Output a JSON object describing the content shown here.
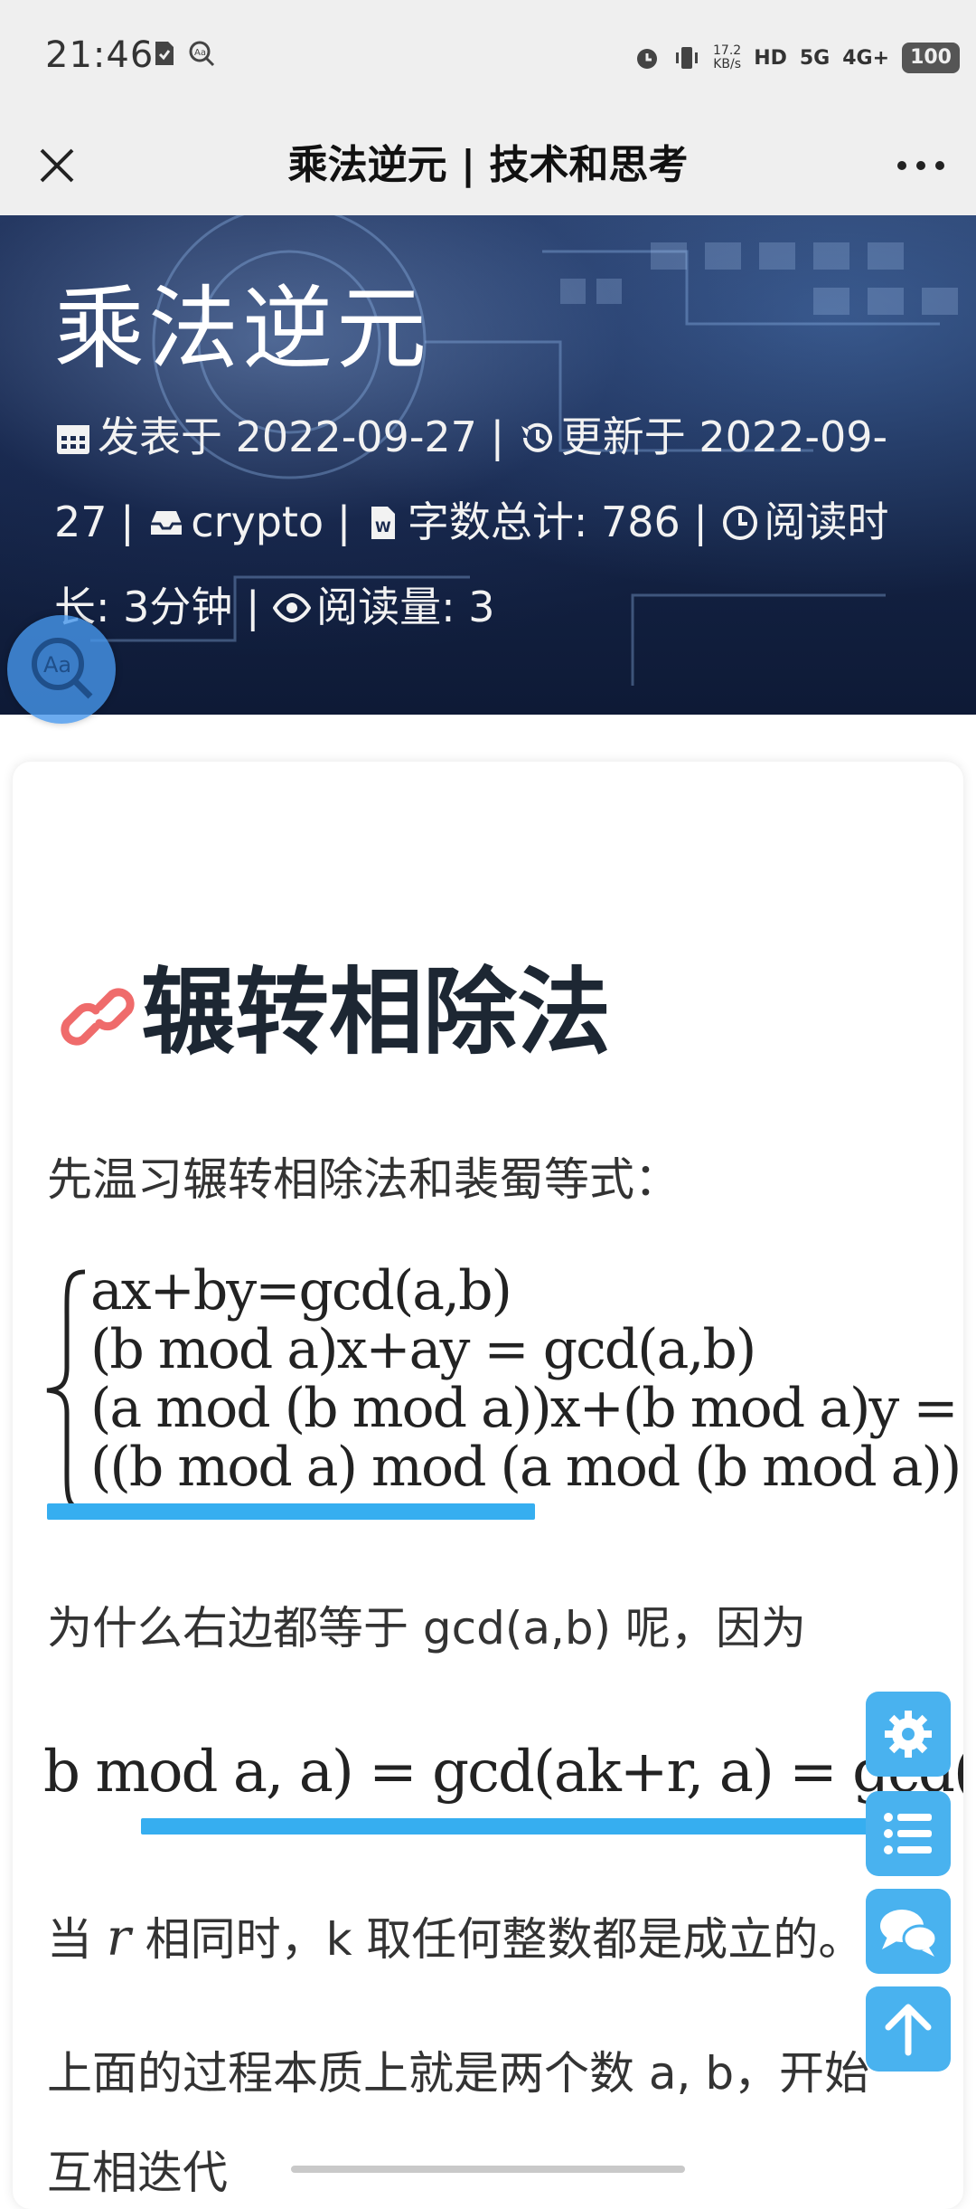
{
  "status_bar": {
    "time": "21:46",
    "speed_value": "17.2",
    "speed_unit": "KB/s",
    "hd_tag": "HD",
    "net_5g": "5G",
    "net_4g": "4G+",
    "battery": "100",
    "icons": [
      "sim-card-icon",
      "accessibility-icon",
      "alarm-icon",
      "vibrate-icon"
    ]
  },
  "title_bar": {
    "title": "乘法逆元 | 技术和思考",
    "close_icon": "close-icon",
    "more_icon": "more-dots-icon"
  },
  "hero": {
    "title": "乘法逆元",
    "published_label": "发表于 2022-09-27",
    "updated_label": "更新于 2022-09-27",
    "category": "crypto",
    "word_count": "字数总计: 786",
    "reading_time": "阅读时长: 3分钟",
    "views": "阅读量: 3",
    "sep": "|"
  },
  "article": {
    "heading": "辗转相除法",
    "intro": "先温习辗转相除法和裴蜀等式：",
    "eq1_lines": [
      "ax+by=gcd(a,b)",
      "(b mod a)x+ay = gcd(a,b)",
      "(a mod (b mod a))x+(b mod a)y = g",
      "((b mod a) mod (a mod (b mod a)))x+"
    ],
    "question": "为什么右边都等于 gcd(a,b) 呢，因为",
    "eq2": "b mod a, a) = gcd(ak+r, a) = gcd(r, a)",
    "when_text_pre": "当 ",
    "when_var": "r",
    "when_text_post": " 相同时，k 取任何整数都是成立的。",
    "process_text": "上面的过程本质上就是两个数 a, b，开始",
    "process_text_2": "互相迭代"
  },
  "floating_buttons": [
    "settings-icon",
    "toc-list-icon",
    "comments-icon",
    "back-to-top-icon"
  ],
  "colors": {
    "accent": "#49b2ef",
    "link_icon": "#ef6b6b",
    "heading": "#1d2733"
  }
}
